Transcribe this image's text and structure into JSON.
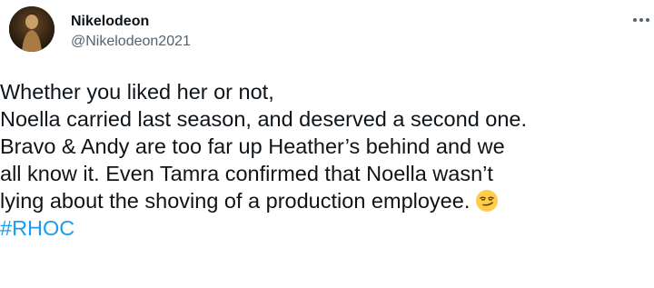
{
  "author": {
    "display_name": "Nikelodeon",
    "handle": "@Nikelodeon2021",
    "avatar_icon": "avatar-image"
  },
  "menu": {
    "icon": "more-horizontal-icon"
  },
  "tweet": {
    "lines": [
      "Whether you liked her or not,",
      "Noella carried last season, and deserved a second one.",
      "Bravo & Andy are too far up Heather’s behind and we",
      "all know it. Even Tamra confirmed that Noella wasn’t",
      "lying about the shoving of a production employee."
    ],
    "emoji": "smirking-face-emoji",
    "hashtag": "#RHOC"
  },
  "colors": {
    "text": "#0f1419",
    "secondary": "#536471",
    "link": "#1d9bf0",
    "background": "#ffffff"
  }
}
